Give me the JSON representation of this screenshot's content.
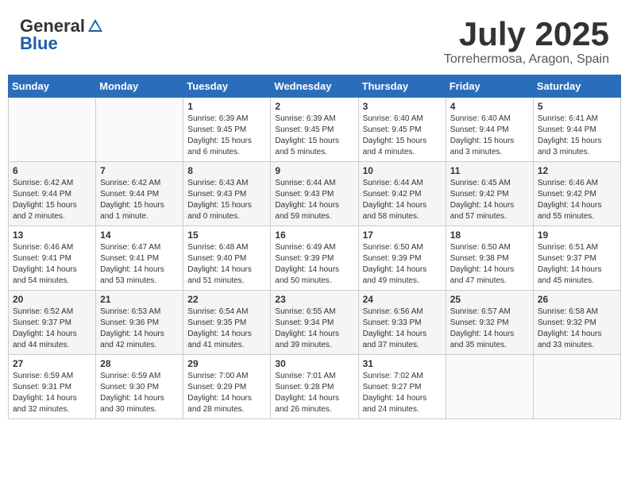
{
  "header": {
    "logo_general": "General",
    "logo_blue": "Blue",
    "month_title": "July 2025",
    "location": "Torrehermosa, Aragon, Spain"
  },
  "weekdays": [
    "Sunday",
    "Monday",
    "Tuesday",
    "Wednesday",
    "Thursday",
    "Friday",
    "Saturday"
  ],
  "weeks": [
    [
      {
        "day": "",
        "info": ""
      },
      {
        "day": "",
        "info": ""
      },
      {
        "day": "1",
        "info": "Sunrise: 6:39 AM\nSunset: 9:45 PM\nDaylight: 15 hours\nand 6 minutes."
      },
      {
        "day": "2",
        "info": "Sunrise: 6:39 AM\nSunset: 9:45 PM\nDaylight: 15 hours\nand 5 minutes."
      },
      {
        "day": "3",
        "info": "Sunrise: 6:40 AM\nSunset: 9:45 PM\nDaylight: 15 hours\nand 4 minutes."
      },
      {
        "day": "4",
        "info": "Sunrise: 6:40 AM\nSunset: 9:44 PM\nDaylight: 15 hours\nand 3 minutes."
      },
      {
        "day": "5",
        "info": "Sunrise: 6:41 AM\nSunset: 9:44 PM\nDaylight: 15 hours\nand 3 minutes."
      }
    ],
    [
      {
        "day": "6",
        "info": "Sunrise: 6:42 AM\nSunset: 9:44 PM\nDaylight: 15 hours\nand 2 minutes."
      },
      {
        "day": "7",
        "info": "Sunrise: 6:42 AM\nSunset: 9:44 PM\nDaylight: 15 hours\nand 1 minute."
      },
      {
        "day": "8",
        "info": "Sunrise: 6:43 AM\nSunset: 9:43 PM\nDaylight: 15 hours\nand 0 minutes."
      },
      {
        "day": "9",
        "info": "Sunrise: 6:44 AM\nSunset: 9:43 PM\nDaylight: 14 hours\nand 59 minutes."
      },
      {
        "day": "10",
        "info": "Sunrise: 6:44 AM\nSunset: 9:42 PM\nDaylight: 14 hours\nand 58 minutes."
      },
      {
        "day": "11",
        "info": "Sunrise: 6:45 AM\nSunset: 9:42 PM\nDaylight: 14 hours\nand 57 minutes."
      },
      {
        "day": "12",
        "info": "Sunrise: 6:46 AM\nSunset: 9:42 PM\nDaylight: 14 hours\nand 55 minutes."
      }
    ],
    [
      {
        "day": "13",
        "info": "Sunrise: 6:46 AM\nSunset: 9:41 PM\nDaylight: 14 hours\nand 54 minutes."
      },
      {
        "day": "14",
        "info": "Sunrise: 6:47 AM\nSunset: 9:41 PM\nDaylight: 14 hours\nand 53 minutes."
      },
      {
        "day": "15",
        "info": "Sunrise: 6:48 AM\nSunset: 9:40 PM\nDaylight: 14 hours\nand 51 minutes."
      },
      {
        "day": "16",
        "info": "Sunrise: 6:49 AM\nSunset: 9:39 PM\nDaylight: 14 hours\nand 50 minutes."
      },
      {
        "day": "17",
        "info": "Sunrise: 6:50 AM\nSunset: 9:39 PM\nDaylight: 14 hours\nand 49 minutes."
      },
      {
        "day": "18",
        "info": "Sunrise: 6:50 AM\nSunset: 9:38 PM\nDaylight: 14 hours\nand 47 minutes."
      },
      {
        "day": "19",
        "info": "Sunrise: 6:51 AM\nSunset: 9:37 PM\nDaylight: 14 hours\nand 45 minutes."
      }
    ],
    [
      {
        "day": "20",
        "info": "Sunrise: 6:52 AM\nSunset: 9:37 PM\nDaylight: 14 hours\nand 44 minutes."
      },
      {
        "day": "21",
        "info": "Sunrise: 6:53 AM\nSunset: 9:36 PM\nDaylight: 14 hours\nand 42 minutes."
      },
      {
        "day": "22",
        "info": "Sunrise: 6:54 AM\nSunset: 9:35 PM\nDaylight: 14 hours\nand 41 minutes."
      },
      {
        "day": "23",
        "info": "Sunrise: 6:55 AM\nSunset: 9:34 PM\nDaylight: 14 hours\nand 39 minutes."
      },
      {
        "day": "24",
        "info": "Sunrise: 6:56 AM\nSunset: 9:33 PM\nDaylight: 14 hours\nand 37 minutes."
      },
      {
        "day": "25",
        "info": "Sunrise: 6:57 AM\nSunset: 9:32 PM\nDaylight: 14 hours\nand 35 minutes."
      },
      {
        "day": "26",
        "info": "Sunrise: 6:58 AM\nSunset: 9:32 PM\nDaylight: 14 hours\nand 33 minutes."
      }
    ],
    [
      {
        "day": "27",
        "info": "Sunrise: 6:59 AM\nSunset: 9:31 PM\nDaylight: 14 hours\nand 32 minutes."
      },
      {
        "day": "28",
        "info": "Sunrise: 6:59 AM\nSunset: 9:30 PM\nDaylight: 14 hours\nand 30 minutes."
      },
      {
        "day": "29",
        "info": "Sunrise: 7:00 AM\nSunset: 9:29 PM\nDaylight: 14 hours\nand 28 minutes."
      },
      {
        "day": "30",
        "info": "Sunrise: 7:01 AM\nSunset: 9:28 PM\nDaylight: 14 hours\nand 26 minutes."
      },
      {
        "day": "31",
        "info": "Sunrise: 7:02 AM\nSunset: 9:27 PM\nDaylight: 14 hours\nand 24 minutes."
      },
      {
        "day": "",
        "info": ""
      },
      {
        "day": "",
        "info": ""
      }
    ]
  ]
}
